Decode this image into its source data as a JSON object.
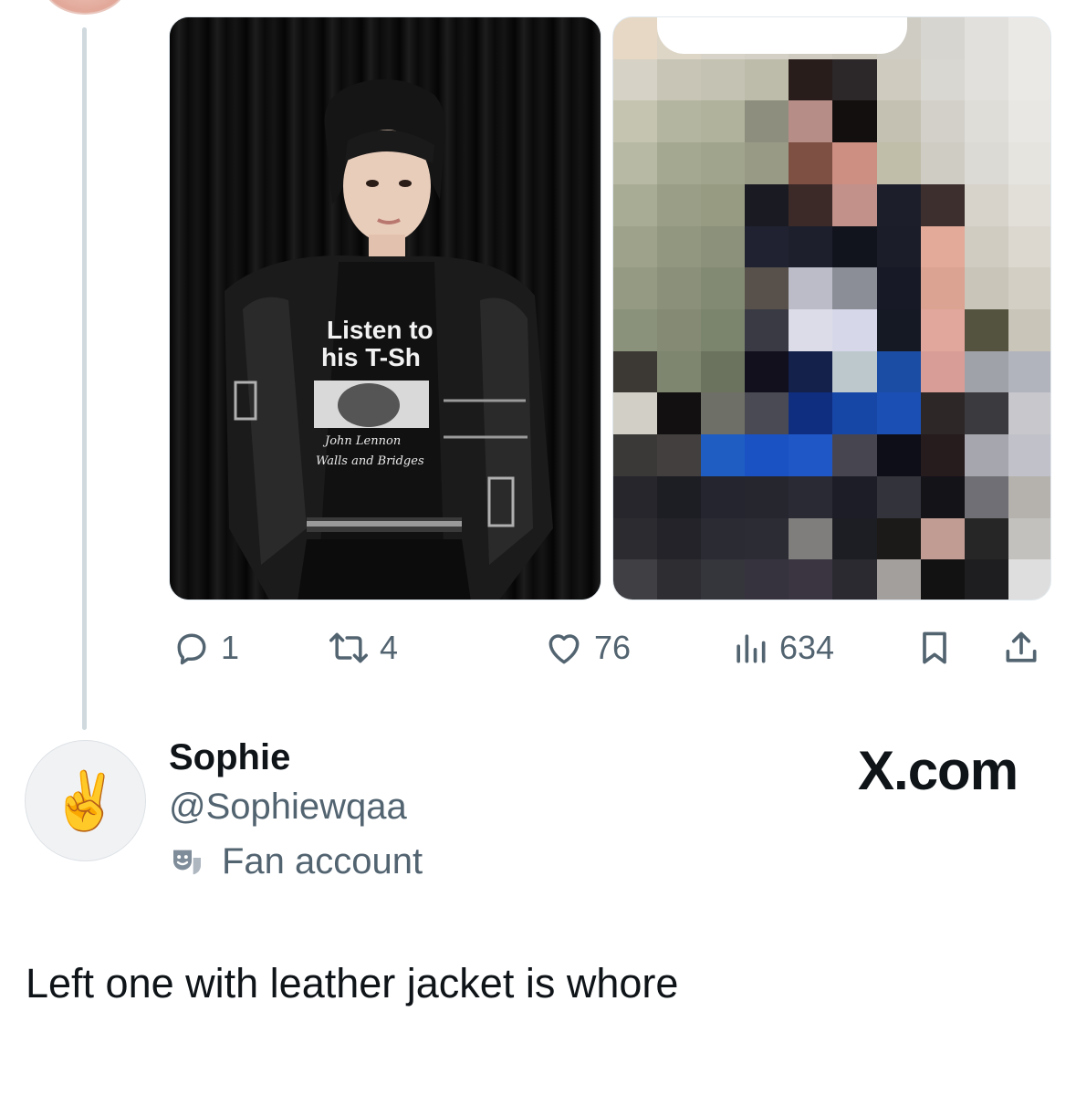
{
  "parent_post": {
    "media": [
      {
        "kind": "photo",
        "shirt_text": [
          "Listen to",
          "his T-Sh"
        ],
        "shirt_signature": [
          "John Lennon",
          "Walls and Bridges"
        ]
      },
      {
        "kind": "pixelated-photo"
      }
    ],
    "actions": {
      "reply_count": "1",
      "repost_count": "4",
      "like_count": "76",
      "view_count": "634"
    }
  },
  "reply": {
    "display_name": "Sophie",
    "handle": "@Sophiewqaa",
    "badge_icon": "theater-masks-icon",
    "badge_label": "Fan account",
    "avatar_emoji": "✌️",
    "text": "Left one with leather jacket is whore"
  },
  "watermark": {
    "text": "X.com"
  },
  "colors": {
    "muted": "#536471",
    "text": "#0f1419",
    "thread_line": "#cfd9de"
  }
}
